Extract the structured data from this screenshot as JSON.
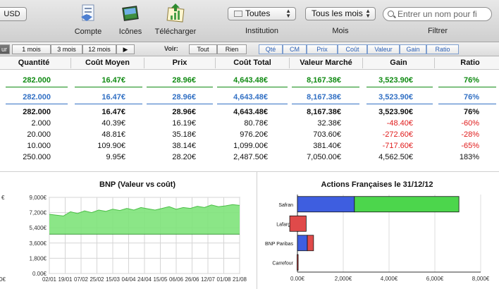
{
  "toolbar": {
    "currency": "USD",
    "tools": [
      {
        "label": "Compte",
        "icon": "compte-icon"
      },
      {
        "label": "Icônes",
        "icon": "icones-icon"
      },
      {
        "label": "Télécharger",
        "icon": "telecharger-icon"
      }
    ],
    "institution": {
      "value": "Toutes",
      "label": "Institution"
    },
    "period": {
      "value": "Tous les mois",
      "label": "Mois"
    },
    "search": {
      "placeholder": "Entrer un nom pour fi",
      "label": "Filtrer"
    }
  },
  "filterbar": {
    "range_buttons": [
      "ur",
      "1 mois",
      "3 mois",
      "12 mois"
    ],
    "next": "▶",
    "voir_label": "Voir:",
    "voir_buttons": [
      "Tout",
      "Rien"
    ],
    "columns_toggle": [
      "Qté",
      "CM",
      "Prix",
      "Coût",
      "Valeur",
      "Gain",
      "Ratio"
    ]
  },
  "table": {
    "headers": [
      "Quantité",
      "Coût Moyen",
      "Prix",
      "Coût Total",
      "Valeur Marché",
      "Gain",
      "Ratio"
    ],
    "rows": [
      {
        "style": "g",
        "cells": [
          "282.000",
          "16.47€",
          "28.96€",
          "4,643.48€",
          "8,167.38€",
          "3,523.90€",
          "76%"
        ]
      },
      {
        "style": "b",
        "cells": [
          "282.000",
          "16.47€",
          "28.96€",
          "4,643.48€",
          "8,167.38€",
          "3,523.90€",
          "76%"
        ]
      },
      {
        "style": "t",
        "cells": [
          "282.000",
          "16.47€",
          "28.96€",
          "4,643.48€",
          "8,167.38€",
          "3,523.90€",
          "76%"
        ]
      },
      {
        "style": "n",
        "cells": [
          "2.000",
          "40.39€",
          "16.19€",
          "80.78€",
          "32.38€",
          "-48.40€",
          "-60%"
        ]
      },
      {
        "style": "n",
        "cells": [
          "20.000",
          "48.81€",
          "35.18€",
          "976.20€",
          "703.60€",
          "-272.60€",
          "-28%"
        ]
      },
      {
        "style": "n",
        "cells": [
          "10.000",
          "109.90€",
          "38.14€",
          "1,099.00€",
          "381.40€",
          "-717.60€",
          "-65%"
        ]
      },
      {
        "style": "n",
        "cells": [
          "250.000",
          "9.95€",
          "28.20€",
          "2,487.50€",
          "7,050.00€",
          "4,562.50€",
          "183%"
        ]
      }
    ]
  },
  "chart_data": [
    {
      "type": "area",
      "title": "BNP (Valeur vs coût)",
      "y_ticks": [
        "9,000€",
        "7,200€",
        "5,400€",
        "3,600€",
        "1,800€",
        "0.00€"
      ],
      "ylim": [
        0,
        9000
      ],
      "x_ticks": [
        "02/01",
        "19/01",
        "07/02",
        "25/02",
        "15/03",
        "04/04",
        "24/04",
        "15/05",
        "06/06",
        "26/06",
        "12/07",
        "01/08",
        "21/08"
      ],
      "left_tick_fragment": "€",
      "left_bottom_fragment": "0€",
      "series": [
        {
          "name": "",
          "color": "#7ee37a",
          "values": [
            7000,
            6900,
            6800,
            7300,
            7100,
            7400,
            7200,
            7500,
            7350,
            7600,
            7450,
            7700,
            7500,
            7800,
            7650,
            7500,
            7700,
            7900,
            7600,
            7800,
            7700,
            7950,
            7800,
            8100,
            7900,
            8000,
            8150,
            8050
          ]
        },
        {
          "name": "",
          "color": "#3f9b3f",
          "values": [
            4650,
            4650,
            4650,
            4650,
            4650,
            4650,
            4650,
            4650,
            4650,
            4650,
            4650,
            4650,
            4650,
            4650,
            4650,
            4650,
            4650,
            4650,
            4650,
            4650,
            4650,
            4650,
            4650,
            4650,
            4650,
            4650,
            4650,
            4650
          ]
        }
      ]
    },
    {
      "type": "bar",
      "orientation": "horizontal",
      "title": "Actions Françaises le 31/12/12",
      "categories": [
        "Safran",
        "Lafarge",
        "BNP Paribas",
        "Carrefour"
      ],
      "xlim": [
        0,
        8000
      ],
      "x_ticks": [
        "0.00€",
        "2,000€",
        "4,000€",
        "6,000€",
        "8,000€"
      ],
      "series": [
        {
          "name": "",
          "color": "#3e5ee0",
          "values": [
            2487.5,
            381.4,
            703.6,
            32.38
          ]
        },
        {
          "name": "",
          "colors": {
            "gain": "#4cd64c",
            "loss": "#e04a4a"
          },
          "values": [
            4562.5,
            -717.6,
            -272.6,
            -48.4
          ]
        }
      ]
    }
  ]
}
